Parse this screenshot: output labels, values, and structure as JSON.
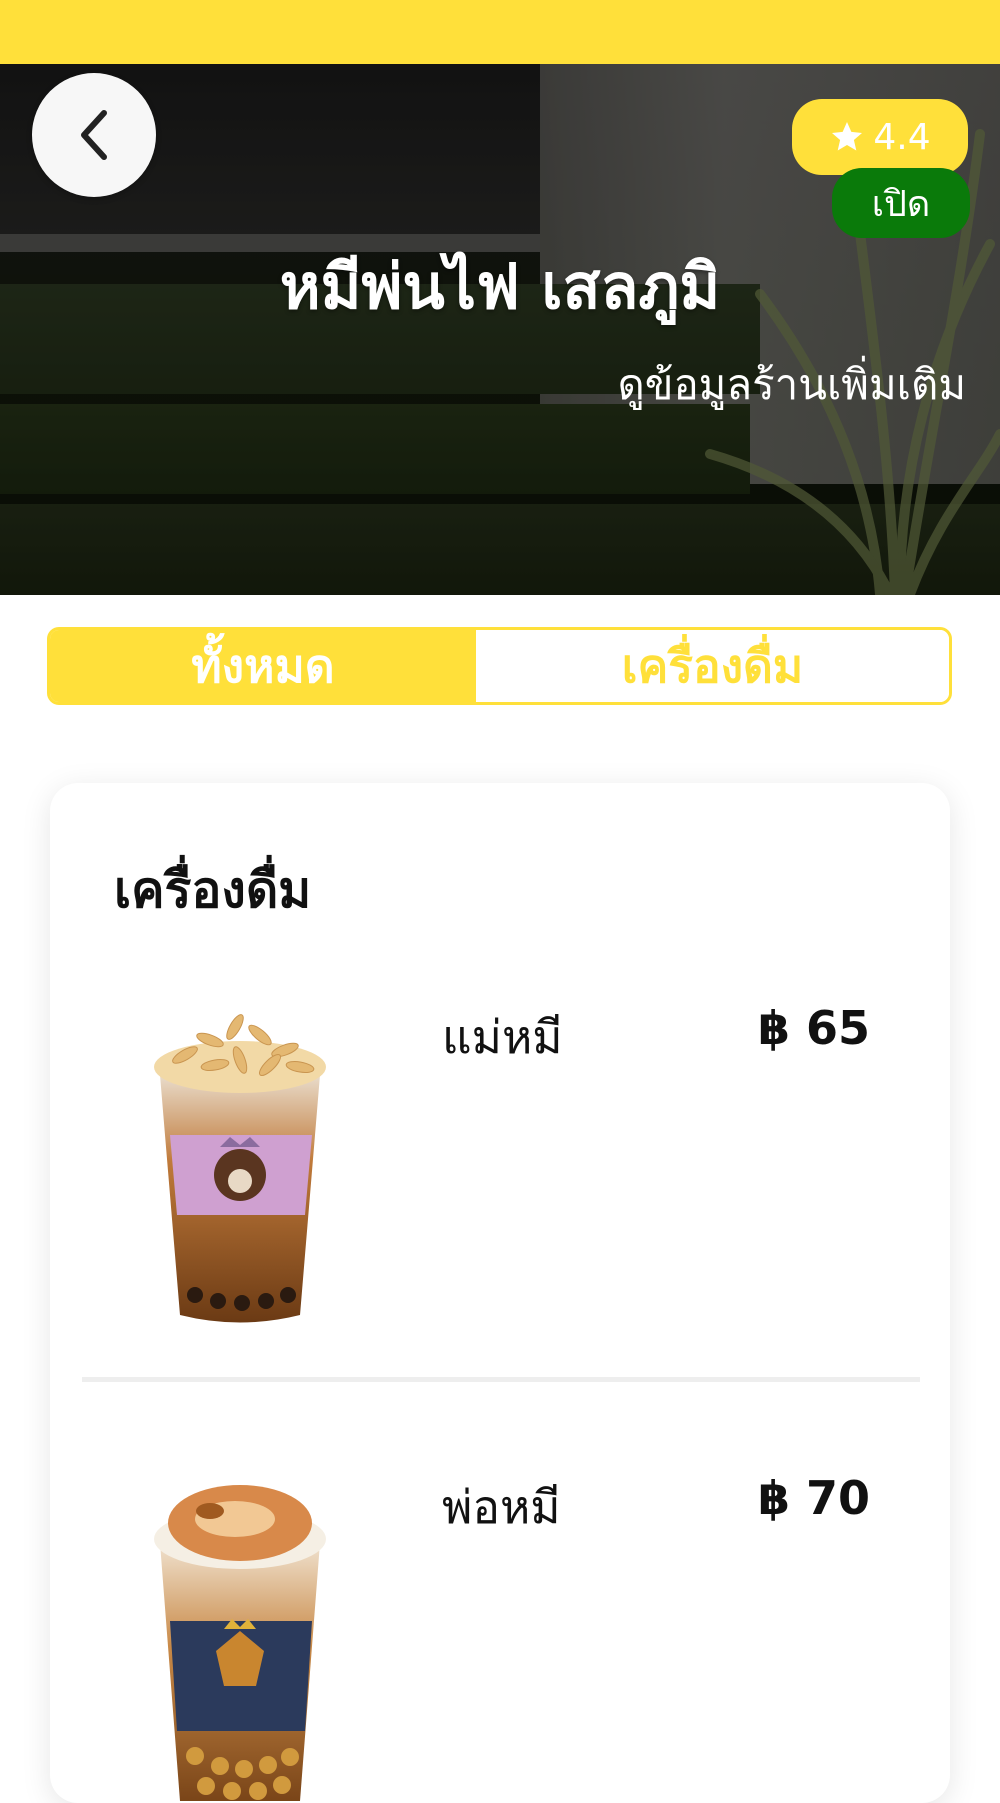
{
  "store": {
    "rating": "4.4",
    "status": "เปิด",
    "name": "หมีพ่นไฟ เสลภูมิ",
    "more_info": "ดูข้อมูลร้านเพิ่มเติม"
  },
  "tabs": [
    {
      "label": "ทั้งหมด",
      "active": true
    },
    {
      "label": "เครื่องดื่ม",
      "active": false
    }
  ],
  "menu": {
    "section_title": "เครื่องดื่ม",
    "items": [
      {
        "name": "แม่หมี",
        "price": "฿ 65"
      },
      {
        "name": "พ่อหมี",
        "price": "฿ 70"
      }
    ]
  },
  "colors": {
    "accent": "#ffe03a",
    "open_status": "#0a7a0a"
  },
  "icons": {
    "back": "chevron-left-icon",
    "rating": "star-icon"
  }
}
